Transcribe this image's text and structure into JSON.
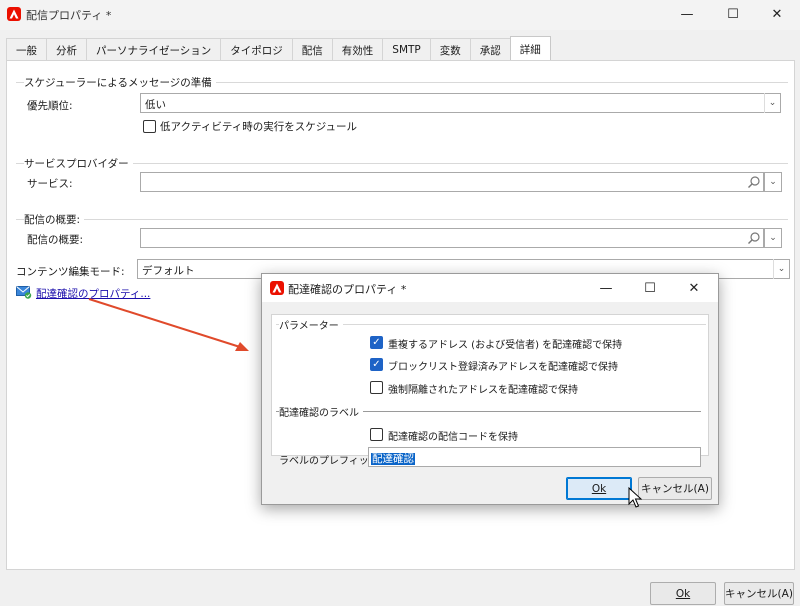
{
  "window": {
    "title": "配信プロパティ *",
    "controls": {
      "minimize": "—",
      "maximize": "☐",
      "close": "✕"
    }
  },
  "tabs": [
    {
      "label": "一般"
    },
    {
      "label": "分析"
    },
    {
      "label": "パーソナライゼーション"
    },
    {
      "label": "タイポロジ"
    },
    {
      "label": "配信"
    },
    {
      "label": "有効性"
    },
    {
      "label": "SMTP"
    },
    {
      "label": "変数"
    },
    {
      "label": "承認"
    },
    {
      "label": "詳細",
      "active": true
    }
  ],
  "scheduler": {
    "group_title": "スケジューラーによるメッセージの準備",
    "priority_label": "優先順位:",
    "priority_value": "低い",
    "low_activity_checkbox": "低アクティビティ時の実行をスケジュール"
  },
  "service_provider": {
    "group_title": "サービスプロバイダー",
    "service_label": "サービス:",
    "service_value": ""
  },
  "delivery_summary": {
    "group_title": "配信の概要:",
    "label": "配信の概要:",
    "value": ""
  },
  "content_mode": {
    "label": "コンテンツ編集モード:",
    "value": "デフォルト"
  },
  "tracking_link": "配達確認のプロパティ...",
  "footer": {
    "ok": "Ok",
    "cancel": "キャンセル(A)"
  },
  "dialog": {
    "title": "配達確認のプロパティ *",
    "controls": {
      "minimize": "—",
      "maximize": "☐",
      "close": "✕"
    },
    "params_title": "パラメーター",
    "options": [
      {
        "label": "重複するアドレス (および受信者) を配達確認で保持",
        "checked": true
      },
      {
        "label": "ブロックリスト登録済みアドレスを配達確認で保持",
        "checked": true
      },
      {
        "label": "強制隔離されたアドレスを配達確認で保持",
        "checked": false
      }
    ],
    "label_section_title": "配達確認のラベル",
    "keep_code_checkbox": "配達確認の配信コードを保持",
    "prefix_label": "ラベルのプレフィックス:",
    "prefix_value": "配達確認",
    "ok": "Ok",
    "cancel": "キャンセル(A)"
  },
  "colors": {
    "accent": "#0078d4",
    "brand": "#eb1000",
    "annotation_arrow": "#e04a2b",
    "checkbox": "#1e63c6"
  }
}
